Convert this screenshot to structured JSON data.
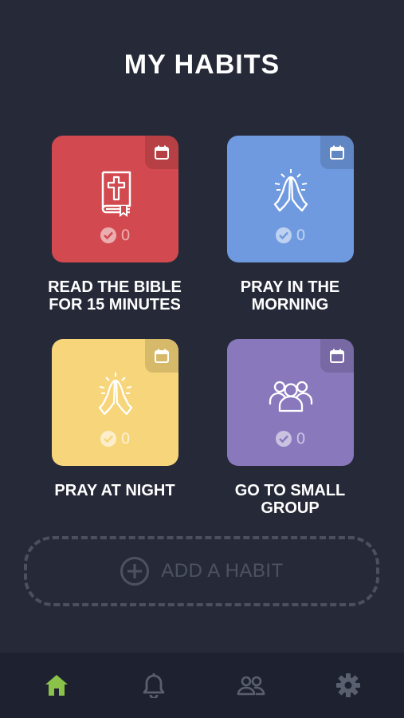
{
  "header": {
    "title": "MY HABITS"
  },
  "habits": [
    {
      "label_line1": "READ THE BIBLE",
      "label_line2": "FOR 15 MINUTES",
      "count": "0",
      "color": "#d24a4f",
      "icon": "bible-icon"
    },
    {
      "label_line1": "PRAY IN THE",
      "label_line2": "MORNING",
      "count": "0",
      "color": "#6f9ae0",
      "icon": "praying-hands-icon"
    },
    {
      "label_line1": "PRAY AT NIGHT",
      "label_line2": "",
      "count": "0",
      "color": "#f7d57a",
      "icon": "praying-hands-icon"
    },
    {
      "label_line1": "GO TO SMALL",
      "label_line2": "GROUP",
      "count": "0",
      "color": "#8a78bd",
      "icon": "group-icon"
    }
  ],
  "add_habit": {
    "label": "ADD A HABIT",
    "icon": "plus-circle-icon"
  },
  "tabbar": {
    "tabs": [
      {
        "name": "home",
        "icon": "home-icon",
        "active": true
      },
      {
        "name": "reminders",
        "icon": "bell-icon",
        "active": false
      },
      {
        "name": "community",
        "icon": "people-icon",
        "active": false
      },
      {
        "name": "settings",
        "icon": "gear-icon",
        "active": false
      }
    ],
    "active_color": "#8bc34a",
    "inactive_color": "#5a5f70"
  }
}
